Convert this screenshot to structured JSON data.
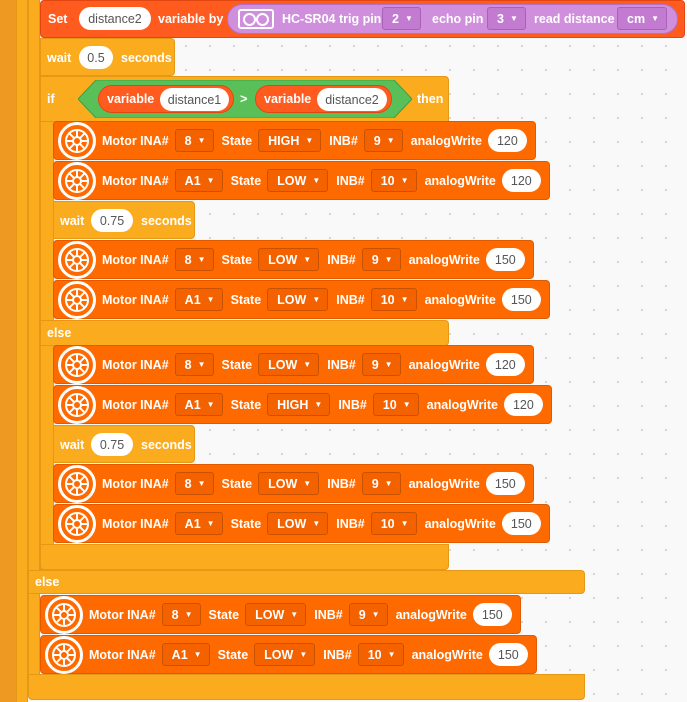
{
  "set_block": {
    "set_label": "Set",
    "variable_name": "distance2",
    "variable_by_label": "variable by",
    "sensor_label": "HC-SR04 trig pin",
    "trig_pin": "2",
    "echo_label": "echo pin",
    "echo_pin": "3",
    "read_label": "read distance",
    "unit": "cm"
  },
  "wait_top": {
    "label": "wait",
    "value": "0.5",
    "unit": "seconds"
  },
  "if_block": {
    "if_label": "if",
    "left_label": "variable",
    "left_var": "distance1",
    "operator": ">",
    "right_label": "variable",
    "right_var": "distance2",
    "then_label": "then"
  },
  "labels": {
    "motor": "Motor INA#",
    "state": "State",
    "inb": "INB#",
    "analog": "analogWrite",
    "wait": "wait",
    "seconds": "seconds",
    "else": "else"
  },
  "motors": [
    {
      "ina": "8",
      "state": "HIGH",
      "inb": "9",
      "val": "120"
    },
    {
      "ina": "A1",
      "state": "LOW",
      "inb": "10",
      "val": "120"
    },
    {
      "ina": "8",
      "state": "LOW",
      "inb": "9",
      "val": "150"
    },
    {
      "ina": "A1",
      "state": "LOW",
      "inb": "10",
      "val": "150"
    },
    {
      "ina": "8",
      "state": "LOW",
      "inb": "9",
      "val": "120"
    },
    {
      "ina": "A1",
      "state": "HIGH",
      "inb": "10",
      "val": "120"
    },
    {
      "ina": "8",
      "state": "LOW",
      "inb": "9",
      "val": "150"
    },
    {
      "ina": "A1",
      "state": "LOW",
      "inb": "10",
      "val": "150"
    },
    {
      "ina": "8",
      "state": "LOW",
      "inb": "9",
      "val": "150"
    },
    {
      "ina": "A1",
      "state": "LOW",
      "inb": "10",
      "val": "150"
    }
  ],
  "waits_inner": [
    {
      "value": "0.75"
    },
    {
      "value": "0.75"
    }
  ],
  "colors": {
    "motor_block": "#ff6a00",
    "control": "#fbab1e",
    "operator": "#59c059",
    "sensor": "#cf8fdc",
    "set_block": "#ff5b1f"
  }
}
